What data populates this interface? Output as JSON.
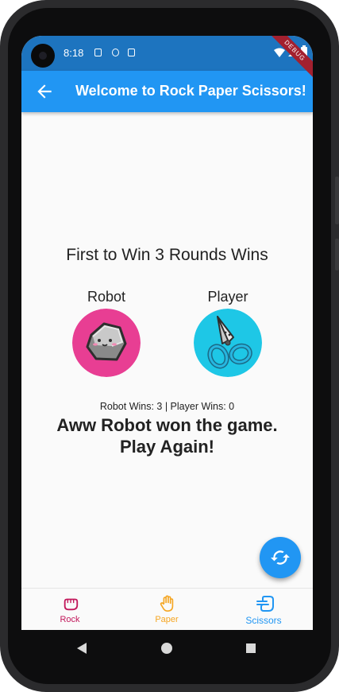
{
  "status": {
    "time": "8:18"
  },
  "appbar": {
    "title": "Welcome to Rock Paper Scissors!",
    "debug_banner": "DEBUG"
  },
  "game": {
    "heading": "First to Win 3 Rounds Wins",
    "robot_label": "Robot",
    "player_label": "Player",
    "score_text": "Robot Wins: 3 | Player Wins: 0",
    "result_line1": "Aww Robot won the game.",
    "result_line2": "Play Again!"
  },
  "nav": {
    "items": [
      {
        "label": "Rock",
        "icon": "hand-rock-icon",
        "color": "#c2185b"
      },
      {
        "label": "Paper",
        "icon": "hand-paper-icon",
        "color": "#f5a623"
      },
      {
        "label": "Scissors",
        "icon": "hand-scissors-icon",
        "color": "#2196f3",
        "selected": true
      }
    ]
  },
  "colors": {
    "appbar": "#2196f3",
    "statusbar": "#1d74bf",
    "robot_avatar_bg": "#e83e93",
    "player_avatar_bg": "#1ec7e6"
  }
}
